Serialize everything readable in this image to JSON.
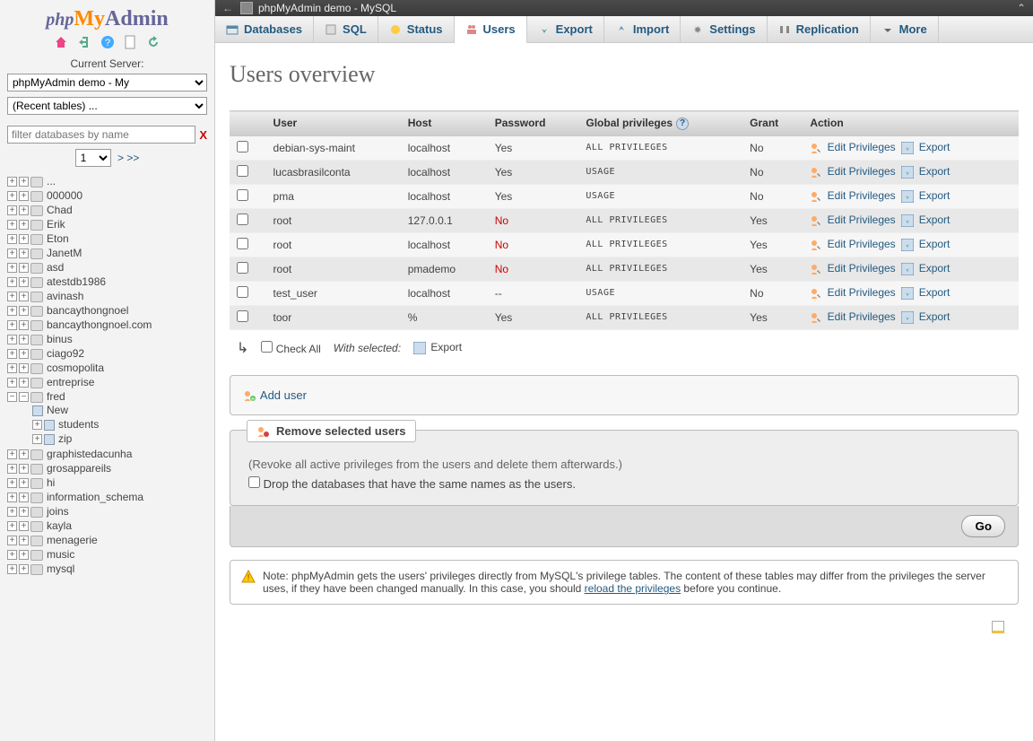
{
  "sidebar": {
    "server_label": "Current Server:",
    "server_select": "phpMyAdmin demo - My",
    "recent_select": "(Recent tables) ...",
    "filter_placeholder": "filter databases by name",
    "page_select": "1",
    "page_next": "> >>",
    "databases": [
      "...",
      "000000",
      "Chad",
      "Erik",
      "Eton",
      "JanetM",
      "asd",
      "atestdb1986",
      "avinash",
      "bancaythongnoel",
      "bancaythongnoel.com",
      "binus",
      "ciago92",
      "cosmopolita",
      "entreprise"
    ],
    "fred": {
      "name": "fred",
      "children": [
        "New",
        "students",
        "zip"
      ]
    },
    "databases2": [
      "graphistedacunha",
      "grosappareils",
      "hi",
      "information_schema",
      "joins",
      "kayla",
      "menagerie",
      "music",
      "mysql"
    ]
  },
  "titlebar": {
    "title": "phpMyAdmin demo - MySQL"
  },
  "tabs": [
    "Databases",
    "SQL",
    "Status",
    "Users",
    "Export",
    "Import",
    "Settings",
    "Replication",
    "More"
  ],
  "active_tab": 3,
  "heading": "Users overview",
  "columns": [
    "",
    "User",
    "Host",
    "Password",
    "Global privileges",
    "Grant",
    "Action"
  ],
  "rows": [
    {
      "user": "debian-sys-maint",
      "host": "localhost",
      "pw": "Yes",
      "priv": "ALL PRIVILEGES",
      "grant": "No"
    },
    {
      "user": "lucasbrasilconta",
      "host": "localhost",
      "pw": "Yes",
      "priv": "USAGE",
      "grant": "No"
    },
    {
      "user": "pma",
      "host": "localhost",
      "pw": "Yes",
      "priv": "USAGE",
      "grant": "No"
    },
    {
      "user": "root",
      "host": "127.0.0.1",
      "pw": "No",
      "priv": "ALL PRIVILEGES",
      "grant": "Yes"
    },
    {
      "user": "root",
      "host": "localhost",
      "pw": "No",
      "priv": "ALL PRIVILEGES",
      "grant": "Yes"
    },
    {
      "user": "root",
      "host": "pmademo",
      "pw": "No",
      "priv": "ALL PRIVILEGES",
      "grant": "Yes"
    },
    {
      "user": "test_user",
      "host": "localhost",
      "pw": "--",
      "priv": "USAGE",
      "grant": "No"
    },
    {
      "user": "toor",
      "host": "%",
      "pw": "Yes",
      "priv": "ALL PRIVILEGES",
      "grant": "Yes"
    }
  ],
  "action_edit": "Edit Privileges",
  "action_export": "Export",
  "check_all": "Check All",
  "with_selected": "With selected:",
  "bulk_export": "Export",
  "add_user": "Add user",
  "remove_legend": "Remove selected users",
  "remove_note": "(Revoke all active privileges from the users and delete them afterwards.)",
  "drop_db": "Drop the databases that have the same names as the users.",
  "go": "Go",
  "note_pre": "Note: phpMyAdmin gets the users' privileges directly from MySQL's privilege tables. The content of these tables may differ from the privileges the server uses, if they have been changed manually. In this case, you should ",
  "note_link": "reload the privileges",
  "note_post": " before you continue."
}
